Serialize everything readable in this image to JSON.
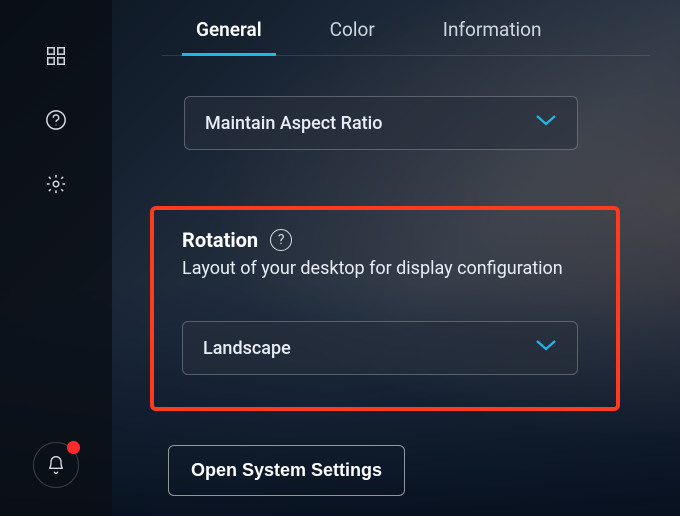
{
  "tabs": {
    "general": "General",
    "color": "Color",
    "information": "Information"
  },
  "scaling_dropdown": {
    "value": "Maintain Aspect Ratio"
  },
  "rotation": {
    "title": "Rotation",
    "description": "Layout of your desktop for display configuration",
    "value": "Landscape"
  },
  "system_settings_button": "Open System Settings"
}
